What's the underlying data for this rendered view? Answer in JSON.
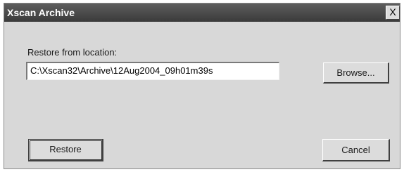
{
  "window": {
    "title": "Xscan Archive",
    "close_glyph": "X"
  },
  "restore": {
    "label": "Restore from location:",
    "path_value": "C:\\Xscan32\\Archive\\12Aug2004_09h01m39s"
  },
  "buttons": {
    "browse_label": "Browse...",
    "restore_label": "Restore",
    "cancel_label": "Cancel"
  },
  "colors": {
    "titlebar": "#4a4a4a",
    "dialog_face": "#d8d8d8",
    "input_bg": "#ffffff"
  }
}
